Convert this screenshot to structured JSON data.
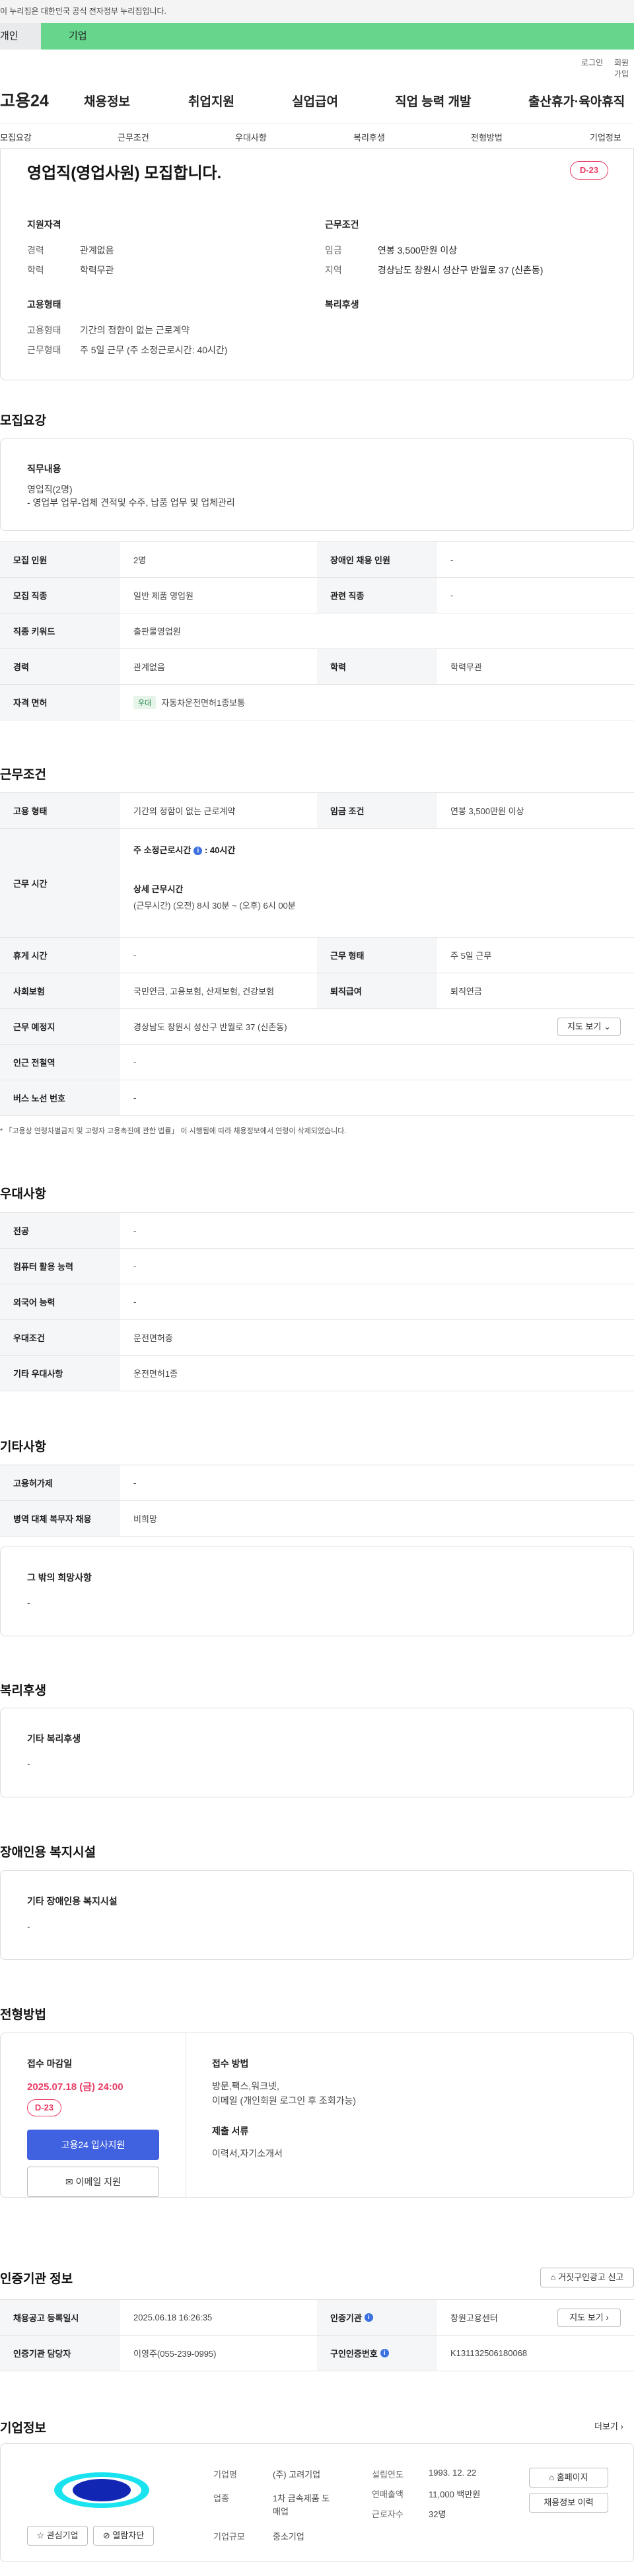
{
  "gov_banner": "이 누리집은 대한민국 공식 전자정부 누리집입니다.",
  "user_tabs": [
    "개인",
    "기업"
  ],
  "util": {
    "login": "로그인",
    "join": "회원가입"
  },
  "gnb": {
    "logo": "고용24",
    "menus": [
      "채용정보",
      "취업지원",
      "실업급여",
      "직업 능력 개발",
      "출산휴가·육아휴직"
    ]
  },
  "subnav": [
    "모집요강",
    "근무조건",
    "우대사항",
    "복리후생",
    "전형방법",
    "기업정보"
  ],
  "summary": {
    "title": "영업직(영업사원) 모집합니다.",
    "dday": "D-23",
    "qual_title": "지원자격",
    "exp_k": "경력",
    "exp_v": "관계없음",
    "edu_k": "학력",
    "edu_v": "학력무관",
    "work_title": "근무조건",
    "wage_k": "임금",
    "wage_v": "연봉 3,500만원 이상",
    "loc_k": "지역",
    "loc_v": "경상남도 창원시 성산구 반월로 37 (신촌동)",
    "emp_title": "고용형태",
    "emptype_k": "고용형태",
    "emptype_v": "기간의 정함이 없는 근로계약",
    "workform_k": "근무형태",
    "workform_v": "주 5일 근무 (주 소정근로시간: 40시간)",
    "welfare_title": "복리후생"
  },
  "recruit": {
    "heading": "모집요강",
    "job_title": "직무내용",
    "job_line1": "영업직(2명)",
    "job_line2": "- 영업부 업무-업체 견적및 수주, 납품 업무 및 업체관리",
    "rows": {
      "count_k": "모집 인원",
      "count_v": "2명",
      "disabled_k": "장애인 채용 인원",
      "disabled_v": "-",
      "jobtype_k": "모집 직종",
      "jobtype_v": "일반 제품 영업원",
      "related_k": "관련 직종",
      "related_v": "-",
      "kw_k": "직종 키워드",
      "kw_v": "출판물영업원",
      "career_k": "경력",
      "career_v": "관계없음",
      "edu_k": "학력",
      "edu_v": "학력무관",
      "license_k": "자격 면허",
      "license_tag": "우대",
      "license_v": "자동차운전면허1종보통"
    }
  },
  "conditions": {
    "heading": "근무조건",
    "emp_k": "고용 형태",
    "emp_v": "기간의 정함이 없는 근로계약",
    "wage_k": "임금 조건",
    "wage_v": "연봉 3,500만원 이상",
    "hours_k": "근무 시간",
    "hours_week": "주 소정근로시간",
    "hours_week_v": "40시간",
    "hours_detail_title": "상세 근무시간",
    "hours_detail": "(근무시간) (오전) 8시 30분 ~ (오후) 6시 00분",
    "rest_k": "휴게 시간",
    "rest_v": "-",
    "form_k": "근무 형태",
    "form_v": "주 5일 근무",
    "insurance_k": "사회보험",
    "insurance_v": "국민연금, 고용보험, 산재보험, 건강보험",
    "retire_k": "퇴직급여",
    "retire_v": "퇴직연금",
    "place_k": "근무 예정지",
    "place_v": "경상남도 창원시 성산구 반월로 37 (신촌동)",
    "map_btn": "지도 보기",
    "station_k": "인근 전철역",
    "station_v": "-",
    "bus_k": "버스 노선 번호",
    "bus_v": "-",
    "note": "* 「고용상 연령차별금지 및 고령자 고용촉진에 관한 법률」 이 시행됨에 따라 채용정보에서 연령이 삭제되었습니다."
  },
  "prefer": {
    "heading": "우대사항",
    "major_k": "전공",
    "major_v": "-",
    "pc_k": "컴퓨터 활용 능력",
    "pc_v": "-",
    "lang_k": "외국어 능력",
    "lang_v": "-",
    "cond_k": "우대조건",
    "cond_v": "운전면허증",
    "etc_k": "기타 우대사항",
    "etc_v": "운전면허1종"
  },
  "other": {
    "heading": "기타사항",
    "foreign_k": "고용허가제",
    "foreign_v": "-",
    "military_k": "병역 대체 복무자 채용",
    "military_v": "비희망",
    "hope_title": "그 밖의 희망사항",
    "hope_v": "-"
  },
  "welfare": {
    "heading": "복리후생",
    "title": "기타 복리후생",
    "value": "-"
  },
  "facility": {
    "heading": "장애인용 복지시설",
    "title": "기타 장애인용 복지시설",
    "value": "-"
  },
  "selection": {
    "heading": "전형방법",
    "deadline_title": "접수 마감일",
    "deadline": "2025.07.18 (금) 24:00",
    "dday": "D-23",
    "apply_btn": "고용24 입사지원",
    "email_btn": "이메일 지원",
    "method_title": "접수 방법",
    "method1": "방문,팩스,워크넷,",
    "method2": "이메일 (개인회원 로그인 후 조회가능)",
    "docs_title": "제출 서류",
    "docs": "이력서,자기소개서"
  },
  "cert": {
    "heading": "인증기관 정보",
    "report_btn": "거짓구인광고 신고",
    "reg_k": "채용공고 등록일시",
    "reg_v": "2025.06.18 16:26:35",
    "org_k": "인증기관",
    "org_v": "창원고용센터",
    "map_btn": "지도 보기",
    "manager_k": "인증기관 담당자",
    "manager_v": "이영주(055-239-0995)",
    "num_k": "구인인증번호",
    "num_v": "K131132506180068"
  },
  "company": {
    "heading": "기업정보",
    "more": "더보기",
    "name_k": "기업명",
    "name_v": "(주) 고려기업",
    "industry_k": "업종",
    "industry_v1": "1차 금속제품 도",
    "industry_v2": "매업",
    "size_k": "기업규모",
    "size_v": "중소기업",
    "founded_k": "설립연도",
    "founded_v": "1993. 12. 22",
    "sales_k": "연매출액",
    "sales_v": "11,000 백만원",
    "staff_k": "근로자수",
    "staff_v": "32명",
    "fav_btn": "관심기업",
    "block_btn": "열람차단",
    "home_btn": "홈페이지",
    "jobs_btn": "채용정보 이력"
  }
}
